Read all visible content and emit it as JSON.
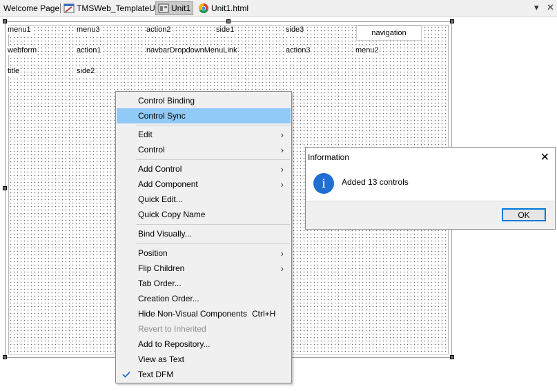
{
  "tabs": {
    "welcome": "Welcome Page",
    "template": "TMSWeb_TemplateUI",
    "unit1": "Unit1",
    "unit1_html": "Unit1.html"
  },
  "form": {
    "components": {
      "menu1": "menu1",
      "menu3": "menu3",
      "action2": "action2",
      "side1": "side1",
      "side3": "side3",
      "webform": "webform",
      "action1": "action1",
      "navbar_dropdown": "navbarDropdownMenuLink",
      "action3": "action3",
      "menu2": "menu2",
      "title": "title",
      "side2": "side2",
      "navigation": "navigation"
    }
  },
  "context_menu": {
    "control_binding": "Control Binding",
    "control_sync": "Control Sync",
    "edit": "Edit",
    "control": "Control",
    "add_control": "Add Control",
    "add_component": "Add Component",
    "quick_edit": "Quick Edit...",
    "quick_copy_name": "Quick Copy Name",
    "bind_visually": "Bind Visually...",
    "position": "Position",
    "flip_children": "Flip Children",
    "tab_order": "Tab Order...",
    "creation_order": "Creation Order...",
    "hide_nonvisual": "Hide Non-Visual Components",
    "hide_nonvisual_shortcut": "Ctrl+H",
    "revert_inherited": "Revert to Inherited",
    "add_repository": "Add to Repository...",
    "view_as_text": "View as Text",
    "text_dfm": "Text DFM",
    "submenu_arrow": "›"
  },
  "dialog": {
    "title": "Information",
    "message": "Added 13 controls",
    "ok": "OK",
    "close": "✕",
    "info_glyph": "i"
  },
  "toolbar_right": {
    "pin": "▾",
    "close": "✕"
  },
  "colors": {
    "highlight": "#91c9f7",
    "check": "#1f6fd0",
    "info_icon": "#1f6fd0"
  }
}
